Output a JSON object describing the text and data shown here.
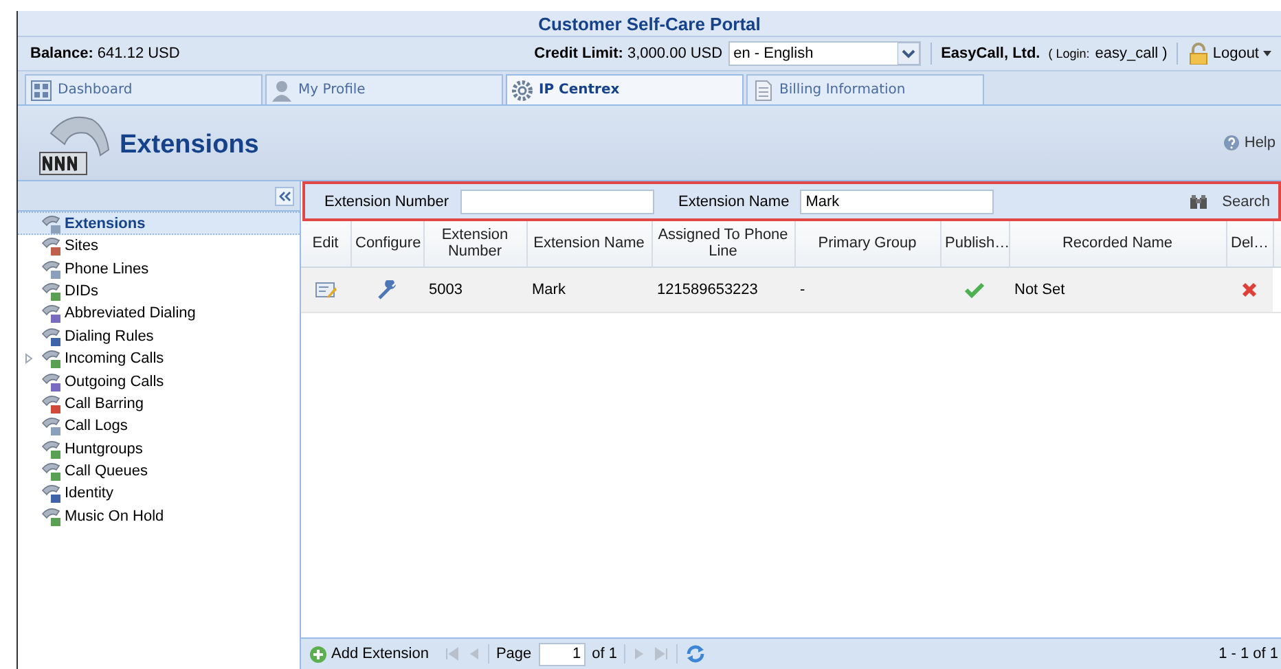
{
  "portal": {
    "title": "Customer Self-Care Portal"
  },
  "account": {
    "balance": "**Balance:** 641.12 USD",
    "credit": "**Credit Limit:** 3,000.00 USD",
    "language": "en - English",
    "company": "EasyCall, Ltd.",
    "login_label": "( Login:",
    "login": "easy_call )",
    "logout": "Logout"
  },
  "tabs": [
    {
      "label": "Dashboard",
      "selected": false
    },
    {
      "label": "My Profile",
      "selected": false
    },
    {
      "label": "IP Centrex",
      "selected": true
    },
    {
      "label": "Billing Information",
      "selected": false
    }
  ],
  "header": {
    "title": "Extensions",
    "help": "Help"
  },
  "sidebar": {
    "items": [
      {
        "label": "Extensions",
        "selected": true,
        "kind": "leaf"
      },
      {
        "label": "Sites",
        "selected": false,
        "kind": "leaf"
      },
      {
        "label": "Phone Lines",
        "selected": false,
        "kind": "leaf"
      },
      {
        "label": "DIDs",
        "selected": false,
        "kind": "leaf"
      },
      {
        "label": "Abbreviated Dialing",
        "selected": false,
        "kind": "leaf"
      },
      {
        "label": "Dialing Rules",
        "selected": false,
        "kind": "leaf"
      },
      {
        "label": "Incoming Calls",
        "selected": false,
        "kind": "folder"
      },
      {
        "label": "Outgoing Calls",
        "selected": false,
        "kind": "leaf"
      },
      {
        "label": "Call Barring",
        "selected": false,
        "kind": "leaf"
      },
      {
        "label": "Call Logs",
        "selected": false,
        "kind": "leaf"
      },
      {
        "label": "Huntgroups",
        "selected": false,
        "kind": "leaf"
      },
      {
        "label": "Call Queues",
        "selected": false,
        "kind": "leaf"
      },
      {
        "label": "Identity",
        "selected": false,
        "kind": "leaf"
      },
      {
        "label": "Music On Hold",
        "selected": false,
        "kind": "leaf"
      }
    ]
  },
  "filters": [
    {
      "label": "Extension Number"
    },
    {
      "label": "Extension Name",
      "value": "Mark"
    }
  ],
  "search": "Search",
  "table": {
    "columns": [
      "Edit",
      "Configure",
      "Extension Number",
      "Extension Name",
      "Assigned To Phone Line",
      "Primary Group",
      "Publish…",
      "Recorded Name",
      "Del…"
    ],
    "rows": [
      {
        "number": "5003",
        "name": "Mark",
        "phone_line": "121589653223",
        "group": "-",
        "published": true,
        "recorded": "Not Set"
      }
    ]
  },
  "footer": {
    "add": "Add Extension",
    "page_label": "Page",
    "page": "1",
    "of": "of 1",
    "range": "1 - 1 of 1"
  }
}
